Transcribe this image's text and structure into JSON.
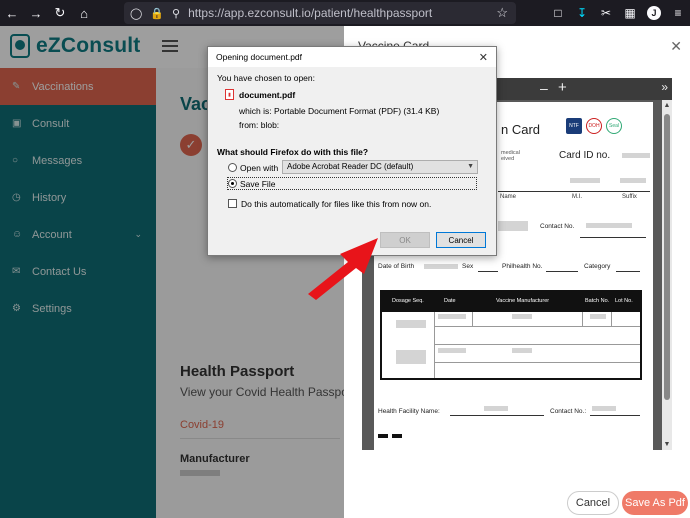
{
  "browser": {
    "url": "https://app.ezconsult.io/patient/healthpassport"
  },
  "app": {
    "logo": "eZConsult",
    "sidebar": [
      {
        "label": "Vaccinations",
        "icon": "syringe-icon",
        "active": true
      },
      {
        "label": "Consult",
        "icon": "consult-icon"
      },
      {
        "label": "Messages",
        "icon": "message-icon"
      },
      {
        "label": "History",
        "icon": "history-icon"
      },
      {
        "label": "Account",
        "icon": "user-icon",
        "has_chevron": true
      },
      {
        "label": "Contact Us",
        "icon": "contact-icon"
      },
      {
        "label": "Settings",
        "icon": "gear-icon"
      }
    ],
    "main": {
      "vac_title": "Vac",
      "hp_title": "Health Passport",
      "hp_sub": "View your Covid Health Passport an",
      "tab": "Covid-19",
      "manufacturer_label": "Manufacturer"
    }
  },
  "drawer": {
    "title": "Vaccine Card",
    "cancel": "Cancel",
    "save": "Save As Pdf",
    "pdf": {
      "card_title": "n Card",
      "card_id": "Card ID no.",
      "medical_1": "medical",
      "medical_2": "eived",
      "name_labels": [
        "Name",
        "M.I.",
        "Suffix"
      ],
      "contact_no": "Contact No.",
      "dob": "Date of Birth",
      "sex": "Sex",
      "philhealth": "Philhealth No.",
      "category": "Category",
      "table_headers": [
        "Dosage Seq.",
        "Date",
        "Vaccine Manufacturer",
        "Batch No.",
        "Lot No."
      ],
      "facility": "Health Facility Name:",
      "contact_no2": "Contact No.:",
      "logos": [
        "NTF",
        "DOH",
        "Seal"
      ]
    }
  },
  "dialog": {
    "title": "Opening document.pdf",
    "chosen": "You have chosen to open:",
    "filename": "document.pdf",
    "which_is": "which is: Portable Document Format (PDF) (31.4 KB)",
    "from": "from: blob:",
    "question": "What should Firefox do with this file?",
    "open_with": "Open with",
    "app_option": "Adobe Acrobat Reader DC (default)",
    "save_file": "Save File",
    "auto": "Do this automatically for files like this from now on.",
    "ok": "OK",
    "cancel": "Cancel"
  },
  "colors": {
    "teal": "#0f6e76",
    "accent": "#e0674f",
    "arrow": "#e8141a"
  }
}
